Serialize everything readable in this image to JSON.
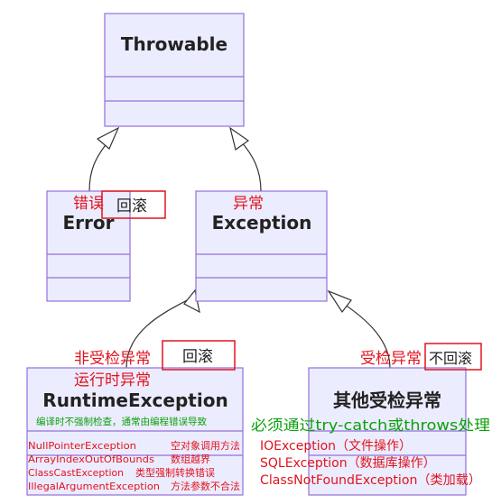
{
  "colors": {
    "class_fill": "#ececff",
    "class_border": "#9370db",
    "edge": "#333333",
    "annotation_red": "#e0141e",
    "annotation_green": "#0ca00c"
  },
  "classes": {
    "throwable": {
      "title": "Throwable"
    },
    "error": {
      "title": "Error",
      "label_cn": "错误",
      "tag": "回滚"
    },
    "exception": {
      "title": "Exception",
      "label_cn": "异常"
    },
    "runtime": {
      "title": "RuntimeException",
      "label_cn_1": "非受检异常",
      "label_cn_2": "运行时异常",
      "tag": "回滚",
      "note": "编译时不强制检查，通常由编程错误导致",
      "members": [
        {
          "name": "NullPointerException",
          "desc": "空对象调用方法"
        },
        {
          "name": "ArrayIndexOutOfBounds",
          "desc": "数组越界"
        },
        {
          "name": "ClassCastException",
          "desc": "类型强制转换错误"
        },
        {
          "name": "IllegalArgumentException",
          "desc": "方法参数不合法"
        }
      ]
    },
    "checked": {
      "title": "其他受检异常",
      "label_cn": "受检异常",
      "tag": "不回滚",
      "note": "必须通过try-catch或throws处理",
      "members": [
        "IOException（文件操作）",
        "SQLException（数据库操作）",
        "ClassNotFoundException（类加载）"
      ]
    }
  }
}
